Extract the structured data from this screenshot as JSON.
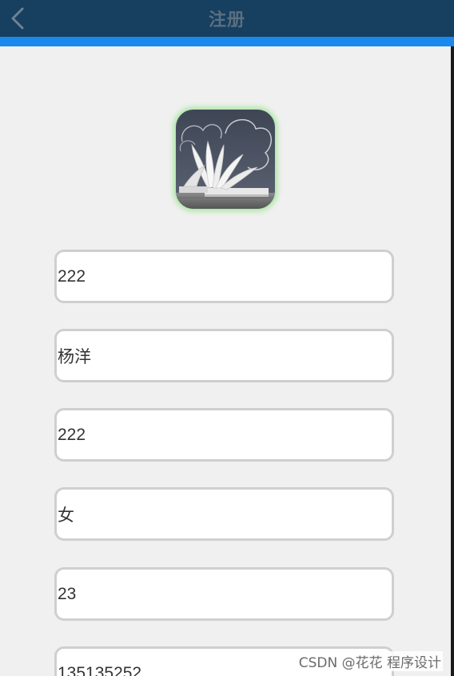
{
  "header": {
    "title": "注册",
    "back_icon": "chevron-left-icon",
    "background_color": "#173f5f",
    "accent_color": "#1b88ee"
  },
  "logo": {
    "icon": "open-book-icon"
  },
  "form": {
    "fields": [
      {
        "name": "username",
        "value": "222"
      },
      {
        "name": "real-name",
        "value": "杨洋"
      },
      {
        "name": "password",
        "value": "222"
      },
      {
        "name": "gender",
        "value": "女"
      },
      {
        "name": "age",
        "value": "23"
      },
      {
        "name": "phone",
        "value": "135135252"
      }
    ]
  },
  "watermark": "CSDN @花花 程序设计"
}
